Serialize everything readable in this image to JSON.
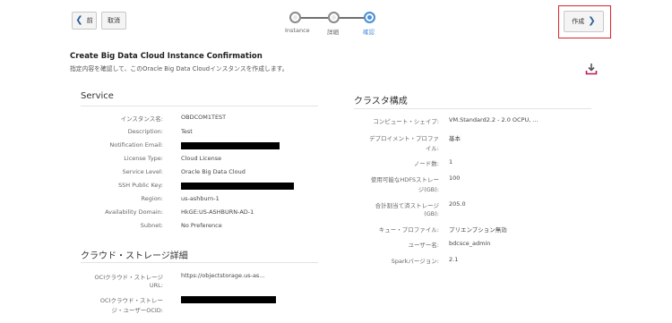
{
  "toolbar": {
    "back_label": "前",
    "cancel_label": "取消",
    "create_label": "作成"
  },
  "train": {
    "steps": [
      {
        "label": "Instance"
      },
      {
        "label": "詳細"
      },
      {
        "label": "確認"
      }
    ]
  },
  "header": {
    "title": "Create Big Data Cloud Instance Confirmation",
    "subtitle": "指定内容を確認して、このOracle Big Data Cloudインスタンスを作成します。"
  },
  "service": {
    "title": "Service",
    "rows": [
      {
        "label": "インスタンス名:",
        "value": "OBDCOM1TEST"
      },
      {
        "label": "Description:",
        "value": "Test"
      },
      {
        "label": "Notification Email:",
        "value": ""
      },
      {
        "label": "License Type:",
        "value": "Cloud License"
      },
      {
        "label": "Service Level:",
        "value": "Oracle Big Data Cloud"
      },
      {
        "label": "SSH Public Key:",
        "value": ""
      },
      {
        "label": "Region:",
        "value": "us-ashburn-1"
      },
      {
        "label": "Availability Domain:",
        "value": "HkGE:US-ASHBURN-AD-1"
      },
      {
        "label": "Subnet:",
        "value": "No Preference"
      }
    ]
  },
  "storage": {
    "title": "クラウド・ストレージ詳細",
    "url_label_1": "OCIクラウド・ストレージ",
    "url_label_2": "URL:",
    "url_value": "https://objectstorage.us-as...",
    "ocid_label_1": "OCIクラウド・ストレー",
    "ocid_label_2": "ジ・ユーザーOCID:"
  },
  "cluster": {
    "title": "クラスタ構成",
    "rows": [
      {
        "label1": "コンピュート・シェイプ:",
        "label2": "",
        "value": "VM.Standard2.2 - 2.0 OCPU, ..."
      },
      {
        "label1": "デプロイメント・プロファ",
        "label2": "イル:",
        "value": "基本"
      },
      {
        "label1": "ノード数:",
        "label2": "",
        "value": "1"
      },
      {
        "label1": "使用可能なHDFSストレー",
        "label2": "ジ(GB):",
        "value": "100"
      },
      {
        "label1": "合計割当て済ストレージ",
        "label2": "(GB):",
        "value": "205.0"
      },
      {
        "label1": "キュー・プロファイル:",
        "label2": "",
        "value": "プリエンプション無効"
      },
      {
        "label1": "ユーザー名:",
        "label2": "",
        "value": "bdcsce_admin"
      },
      {
        "label1": "Sparkバージョン:",
        "label2": "",
        "value": "2.1"
      }
    ]
  },
  "colors": {
    "accent": "#4b8fd8",
    "highlight": "#d9232a",
    "download": "#c0145a"
  },
  "icons": {
    "back": "chevron-left-icon",
    "create": "chevron-right-icon",
    "download": "download-icon"
  }
}
